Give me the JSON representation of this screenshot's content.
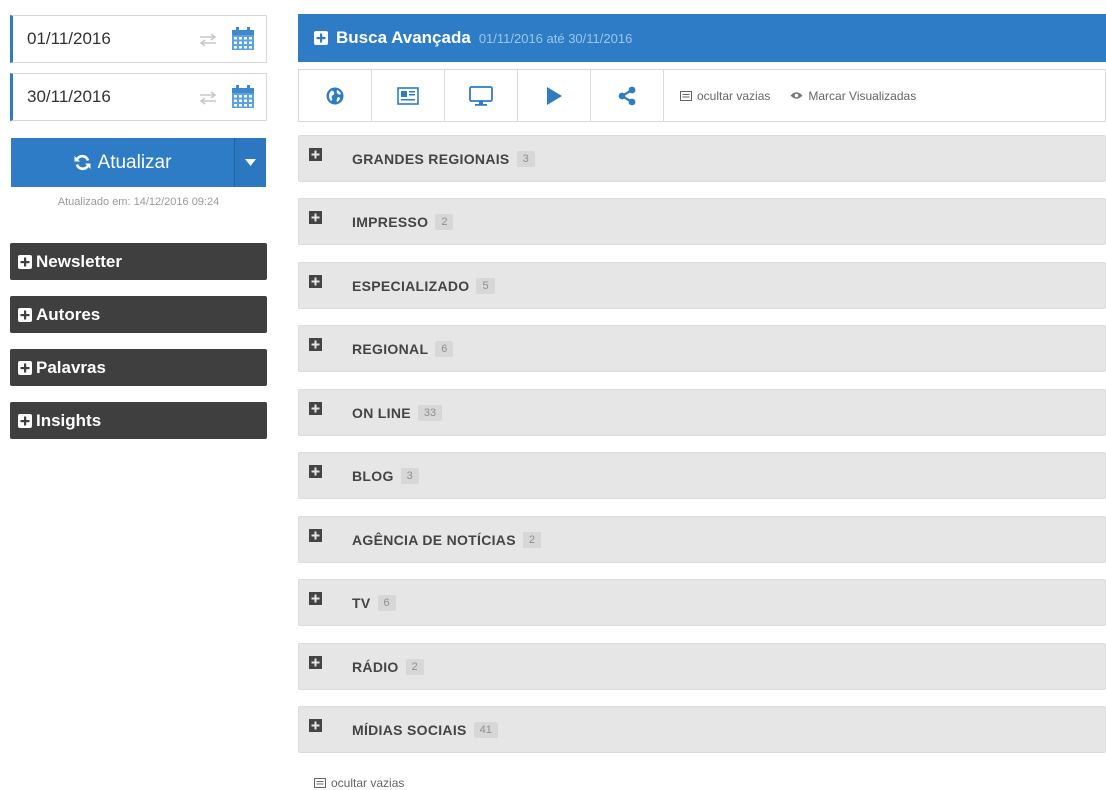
{
  "dates": {
    "start": "01/11/2016",
    "end": "30/11/2016"
  },
  "refresh": {
    "label": "Atualizar",
    "updated": "Atualizado em: 14/12/2016 09:24"
  },
  "side_panels": [
    "Newsletter",
    "Autores",
    "Palavras",
    "Insights"
  ],
  "search": {
    "title": "Busca Avançada",
    "range": "01/11/2016 até 30/11/2016"
  },
  "toolbar": {
    "hide_empty": "ocultar vazias",
    "mark_viewed": "Marcar Visualizadas"
  },
  "categories": [
    {
      "label": "GRANDES REGIONAIS",
      "count": "3"
    },
    {
      "label": "IMPRESSO",
      "count": "2"
    },
    {
      "label": "ESPECIALIZADO",
      "count": "5"
    },
    {
      "label": "REGIONAL",
      "count": "6"
    },
    {
      "label": "ON LINE",
      "count": "33"
    },
    {
      "label": "BLOG",
      "count": "3"
    },
    {
      "label": "AGÊNCIA DE NOTÍCIAS",
      "count": "2"
    },
    {
      "label": "TV",
      "count": "6"
    },
    {
      "label": "RÁDIO",
      "count": "2"
    },
    {
      "label": "MÍDIAS SOCIAIS",
      "count": "41"
    }
  ],
  "footer": {
    "hide_empty": "ocultar vazias"
  },
  "colors": {
    "accent": "#2e7cc6",
    "panel_dark": "#3f3f3f",
    "row_bg": "#e6e6e6"
  }
}
